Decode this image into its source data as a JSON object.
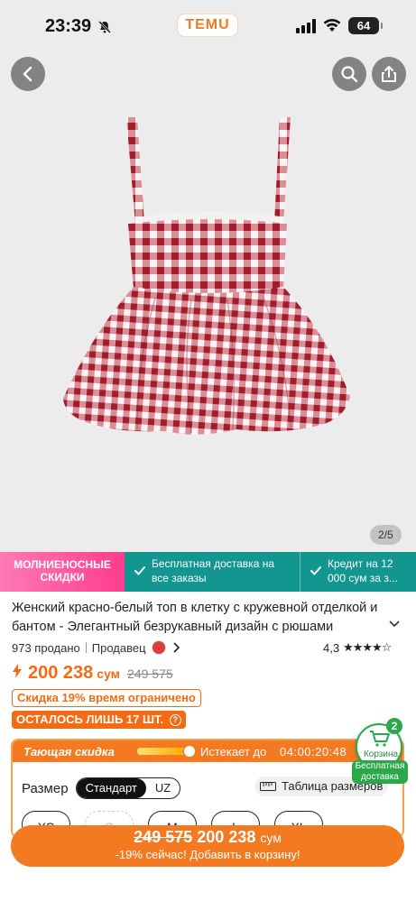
{
  "status": {
    "time": "23:39",
    "battery": "64"
  },
  "header": {
    "brand": "TEMU"
  },
  "gallery": {
    "pager": "2/5"
  },
  "promo": {
    "flash_line1": "МОЛНИЕНОСНЫЕ",
    "flash_line2": "СКИДКИ",
    "item1_line1": "Бесплатная доставка на",
    "item1_line2": "все заказы",
    "item2_line1": "Кредит на 12",
    "item2_line2": "000 сум за з..."
  },
  "product": {
    "title": "Женский красно-белый топ в клетку с кружевной отделкой и бантом - Элегантный безрукавный дизайн с рюшами",
    "sold": "973 продано",
    "seller_label": "Продавец",
    "rating": "4,3",
    "stars": "★★★★☆",
    "price": "200 238",
    "currency": "сум",
    "old_price": "249 575",
    "discount_badge": "Скидка 19% время ограничено",
    "stock_badge": "ОСТАЛОСЬ ЛИШЬ 17 ШТ."
  },
  "selector": {
    "deal_label": "Тающая скидка",
    "expires_label": "Истекает до",
    "countdown": "04:00:20:48",
    "deal_progress": 0.8,
    "size_label": "Размер",
    "size_std": "Стандарт",
    "size_uz": "UZ",
    "size_table": "Таблица размеров",
    "sizes": [
      "XS",
      "S",
      "M",
      "L",
      "XL"
    ]
  },
  "cart": {
    "count": "2",
    "label": "Корзина",
    "free_line1": "Бесплатная",
    "free_line2": "доставка"
  },
  "bottom_bar": {
    "old_price": "249 575",
    "price": "200 238",
    "currency": "сум",
    "cta": "-19% сейчас! Добавить в корзину!"
  },
  "colors": {
    "accent": "#f47a22",
    "teal": "#12968f",
    "pink": "#ff3c8e",
    "green": "#2aa84a"
  }
}
